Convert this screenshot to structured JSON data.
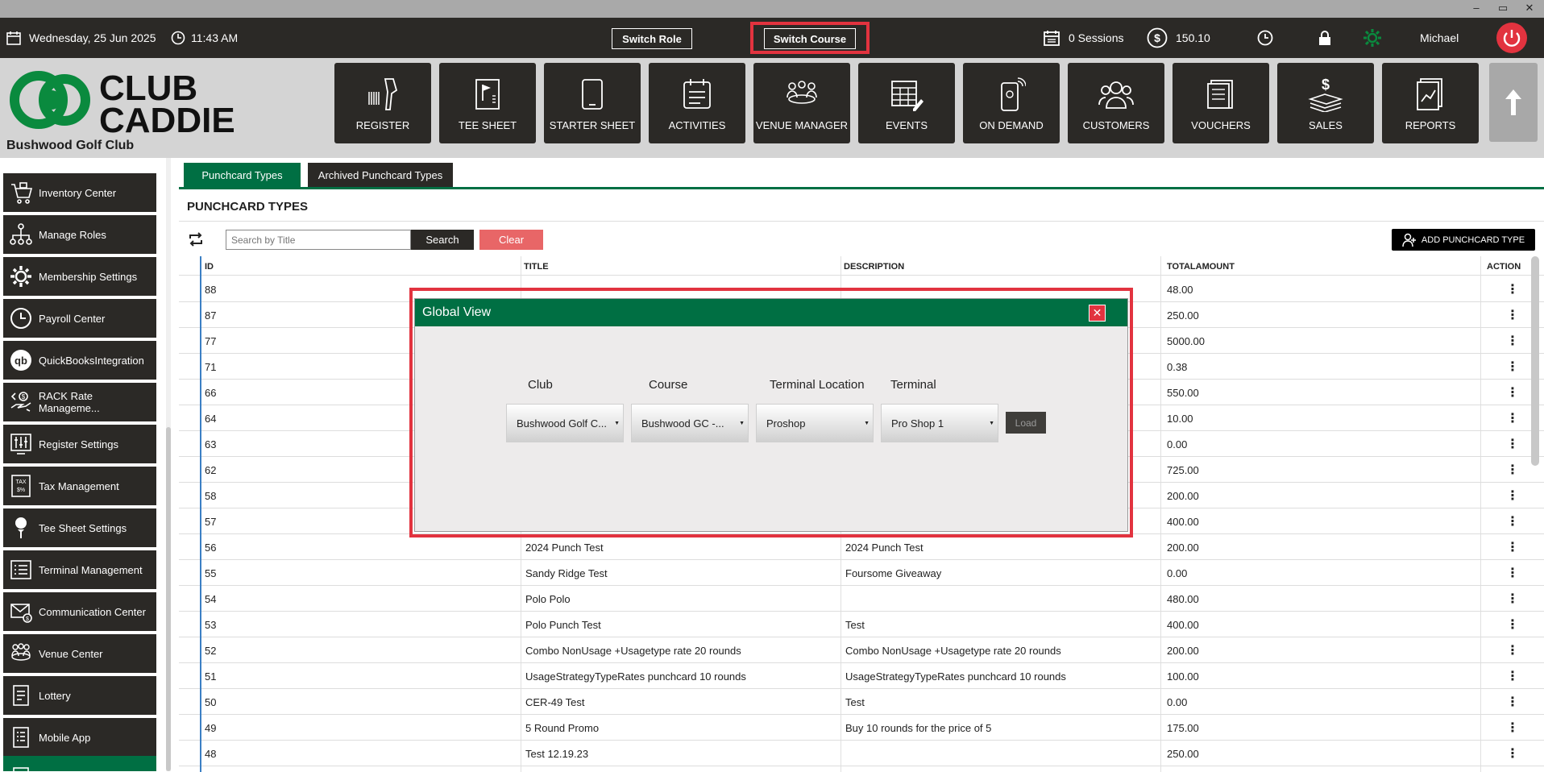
{
  "window": {
    "controls": [
      "–",
      "▭",
      "✕"
    ]
  },
  "topbar": {
    "date": "Wednesday,  25 Jun 2025",
    "time": "11:43 AM",
    "switch_role": "Switch Role",
    "switch_course": "Switch Course",
    "sessions": "0 Sessions",
    "balance": "150.10",
    "user": "Michael"
  },
  "brand": {
    "line1": "CLUB",
    "line2": "CADDIE",
    "club_name": "Bushwood Golf Club",
    "green": "#0a8a3e"
  },
  "nav": [
    {
      "label": "REGISTER",
      "icon": "barcode-scanner-icon"
    },
    {
      "label": "TEE SHEET",
      "icon": "flag-sheet-icon"
    },
    {
      "label": "STARTER SHEET",
      "icon": "tablet-icon"
    },
    {
      "label": "ACTIVITIES",
      "icon": "calendar-list-icon"
    },
    {
      "label": "VENUE MANAGER",
      "icon": "people-table-icon"
    },
    {
      "label": "EVENTS",
      "icon": "calendar-edit-icon"
    },
    {
      "label": "ON DEMAND",
      "icon": "phone-wireless-icon"
    },
    {
      "label": "CUSTOMERS",
      "icon": "group-icon"
    },
    {
      "label": "VOUCHERS",
      "icon": "receipt-icon"
    },
    {
      "label": "SALES",
      "icon": "money-icon"
    },
    {
      "label": "REPORTS",
      "icon": "report-chart-icon"
    }
  ],
  "sidebar": [
    {
      "label": "Inventory Center",
      "icon": "cart-icon"
    },
    {
      "label": "Manage Roles",
      "icon": "org-chart-icon"
    },
    {
      "label": "Membership Settings",
      "icon": "gear-icon"
    },
    {
      "label": "Payroll Center",
      "icon": "clock-icon"
    },
    {
      "label": "QuickBooksIntegration",
      "icon": "quickbooks-icon"
    },
    {
      "label": "RACK Rate Manageme...",
      "icon": "rate-hand-icon"
    },
    {
      "label": "Register Settings",
      "icon": "sliders-icon"
    },
    {
      "label": "Tax Management",
      "icon": "tax-icon"
    },
    {
      "label": "Tee Sheet Settings",
      "icon": "golf-tee-icon"
    },
    {
      "label": "Terminal Management",
      "icon": "terminal-list-icon"
    },
    {
      "label": "Communication Center",
      "icon": "mail-icon"
    },
    {
      "label": "Venue Center",
      "icon": "venue-icon"
    },
    {
      "label": "Lottery",
      "icon": "ticket-icon"
    },
    {
      "label": "Mobile App",
      "icon": "mobile-list-icon"
    }
  ],
  "tabs": {
    "active": "Punchcard Types",
    "inactive": "Archived Punchcard Types"
  },
  "page_title": "PUNCHCARD TYPES",
  "search": {
    "placeholder": "Search by Title",
    "search_label": "Search",
    "clear_label": "Clear"
  },
  "add_button": "ADD PUNCHCARD TYPE",
  "table": {
    "headers": {
      "id": "ID",
      "title": "TITLE",
      "description": "DESCRIPTION",
      "total": "TOTALAMOUNT",
      "action": "ACTION"
    },
    "rows": [
      {
        "id": "88",
        "title": "",
        "description": "",
        "total": "48.00"
      },
      {
        "id": "87",
        "title": "",
        "description": "",
        "total": "250.00"
      },
      {
        "id": "77",
        "title": "",
        "description": "",
        "total": "5000.00"
      },
      {
        "id": "71",
        "title": "",
        "description": "",
        "total": "0.38"
      },
      {
        "id": "66",
        "title": "",
        "description": "",
        "total": "550.00"
      },
      {
        "id": "64",
        "title": "",
        "description": "",
        "total": "10.00"
      },
      {
        "id": "63",
        "title": "",
        "description": "",
        "total": "0.00"
      },
      {
        "id": "62",
        "title": "",
        "description": "",
        "total": "725.00"
      },
      {
        "id": "58",
        "title": "",
        "description": "",
        "total": "200.00"
      },
      {
        "id": "57",
        "title": "",
        "description": "",
        "total": "400.00"
      },
      {
        "id": "56",
        "title": "2024 Punch Test",
        "description": "2024 Punch Test",
        "total": "200.00"
      },
      {
        "id": "55",
        "title": "Sandy Ridge Test",
        "description": "Foursome Giveaway",
        "total": "0.00"
      },
      {
        "id": "54",
        "title": "Polo Polo",
        "description": "",
        "total": "480.00"
      },
      {
        "id": "53",
        "title": "Polo Punch Test",
        "description": "Test",
        "total": "400.00"
      },
      {
        "id": "52",
        "title": "Combo NonUsage +Usagetype rate 20 rounds",
        "description": "Combo NonUsage +Usagetype rate 20 rounds",
        "total": "200.00"
      },
      {
        "id": "51",
        "title": "UsageStrategyTypeRates punchcard 10 rounds",
        "description": "UsageStrategyTypeRates punchcard 10 rounds",
        "total": "100.00"
      },
      {
        "id": "50",
        "title": "CER-49 Test",
        "description": "Test",
        "total": "0.00"
      },
      {
        "id": "49",
        "title": "5 Round Promo",
        "description": "Buy 10 rounds for the price of 5",
        "total": "175.00"
      },
      {
        "id": "48",
        "title": "Test 12.19.23",
        "description": "",
        "total": "250.00"
      }
    ]
  },
  "modal": {
    "title": "Global View",
    "labels": {
      "club": "Club",
      "course": "Course",
      "location": "Terminal Location",
      "terminal": "Terminal"
    },
    "values": {
      "club": "Bushwood Golf C...",
      "course": "Bushwood GC -...",
      "location": "Proshop",
      "terminal": "Pro Shop 1"
    },
    "load_label": "Load"
  }
}
